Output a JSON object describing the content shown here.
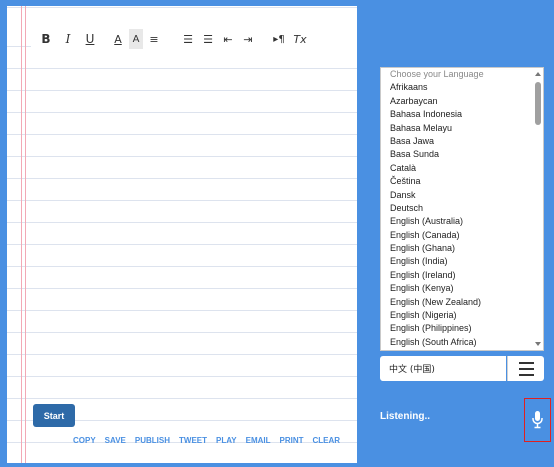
{
  "toolbar": {
    "bold": "B",
    "italic": "I",
    "underline": "U",
    "font_color": "A",
    "bg_color": "A",
    "align": "≡",
    "ordered_list": "☰",
    "bullet_list": "☰",
    "outdent": "⇤",
    "indent": "⇥",
    "text_direction": "▸¶",
    "clear_format": "Tx"
  },
  "start_label": "Start",
  "actions": [
    "COPY",
    "SAVE",
    "PUBLISH",
    "TWEET",
    "PLAY",
    "EMAIL",
    "PRINT",
    "CLEAR"
  ],
  "language_list": {
    "placeholder": "Choose your Language",
    "items": [
      "Afrikaans",
      "Azarbaycan",
      "Bahasa Indonesia",
      "Bahasa Melayu",
      "Basa Jawa",
      "Basa Sunda",
      "Català",
      "Čeština",
      "Dansk",
      "Deutsch",
      "English (Australia)",
      "English (Canada)",
      "English (Ghana)",
      "English (India)",
      "English (Ireland)",
      "English (Kenya)",
      "English (New Zealand)",
      "English (Nigeria)",
      "English (Philippines)",
      "English (South Africa)"
    ]
  },
  "dialect_value": "中文 (中国)",
  "status_text": "Listening..",
  "colors": {
    "background": "#4a90e2",
    "start_button": "#2e6aa8",
    "action_link": "#4a90e2",
    "mic_border": "#e02020"
  },
  "icons": {
    "mic": "microphone-icon",
    "menu": "hamburger-icon"
  }
}
